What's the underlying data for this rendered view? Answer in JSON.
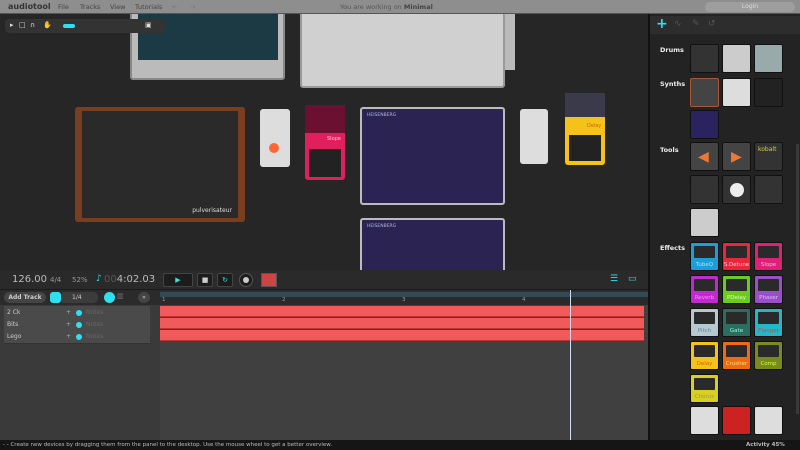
{
  "menubar": {
    "logo": "audiotool",
    "menu": [
      "File",
      "Tracks",
      "View",
      "Tutorials"
    ],
    "working_prefix": "You are working on",
    "project": "Minimal",
    "login": "Login"
  },
  "panel": {
    "categories": {
      "drums": "Drums",
      "synths": "Synths",
      "tools": "Tools",
      "effects": "Effects"
    },
    "tool_label": "kobalt",
    "effects": [
      {
        "label": "TubeQ",
        "color": "#1aa0d8",
        "text": "#bdf"
      },
      {
        "label": "S.Detune",
        "color": "#e8263c",
        "text": "#fcc"
      },
      {
        "label": "Slope",
        "color": "#e01f78",
        "text": "#fbd"
      },
      {
        "label": "Reverb",
        "color": "#c02ad0",
        "text": "#f8f"
      },
      {
        "label": "PDelay",
        "color": "#6ccc1c",
        "text": "#dfb"
      },
      {
        "label": "Phaser",
        "color": "#9a4ec8",
        "text": "#dbf"
      },
      {
        "label": "Pitch",
        "color": "#b8c8d0",
        "text": "#58a"
      },
      {
        "label": "Gate",
        "color": "#2b6e60",
        "text": "#8fd"
      },
      {
        "label": "Flanger",
        "color": "#22b8c8",
        "text": "#c44"
      },
      {
        "label": "Delay",
        "color": "#f5c21a",
        "text": "#c60"
      },
      {
        "label": "Crusher",
        "color": "#f06a10",
        "text": "#fd8"
      },
      {
        "label": "Comp",
        "color": "#7a8a1c",
        "text": "#cf4"
      },
      {
        "label": "Chorus",
        "color": "#d8d020",
        "text": "#995"
      }
    ]
  },
  "transport": {
    "bpm": "126.00",
    "signature": "4/4",
    "percent": "52%",
    "time_dim": "00",
    "time": "4:02.03"
  },
  "tracks_toolbar": {
    "add_track": "Add Track",
    "quantize": "1/4"
  },
  "ruler": [
    "1",
    "2",
    "3",
    "4"
  ],
  "tracks": [
    {
      "name": "2 Ck",
      "type": "Notes"
    },
    {
      "name": "Bits",
      "type": "Notes"
    },
    {
      "name": "Lego",
      "type": "Notes"
    }
  ],
  "devices": {
    "pulverisateur": "pulverisateur",
    "heisenberg": "HEISENBERG",
    "slope": "Slope",
    "delay": "Delay"
  },
  "status": {
    "message": "- - Create new devices by dragging them from the panel to the desktop. Use the mouse wheel to get a better overview.",
    "activity": "Activity 45%"
  },
  "colors": {
    "accent": "#2ee0f0",
    "clip": "#f05a5a"
  }
}
